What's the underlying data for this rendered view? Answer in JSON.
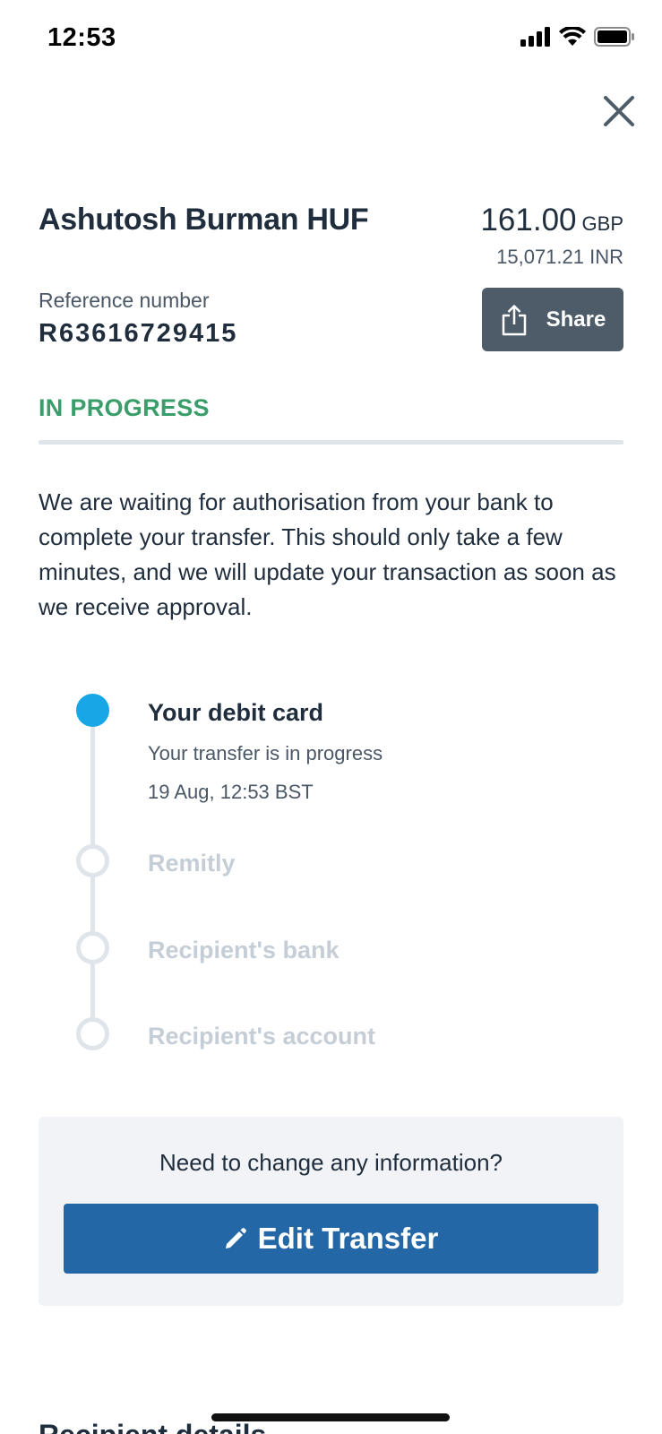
{
  "status_bar": {
    "time": "12:53",
    "icons": [
      "signal-icon",
      "wifi-icon",
      "battery-icon"
    ]
  },
  "transfer": {
    "recipient_name": "Ashutosh Burman HUF",
    "amount": "161.00",
    "currency": "GBP",
    "converted_amount": "15,071.21 INR",
    "reference_label": "Reference number",
    "reference_value": "R63616729415",
    "share_label": "Share",
    "status": "IN PROGRESS",
    "message": "We are waiting for authorisation from your bank to complete your transfer. This should only take a few minutes, and we will update your transaction as soon as we receive approval."
  },
  "timeline": {
    "steps": [
      {
        "title": "Your debit card",
        "subtitle": "Your transfer is in progress",
        "timestamp": "19 Aug, 12:53 BST",
        "active": true
      },
      {
        "title": "Remitly",
        "active": false
      },
      {
        "title": "Recipient's bank",
        "active": false
      },
      {
        "title": "Recipient's account",
        "active": false
      }
    ]
  },
  "change_box": {
    "question": "Need to change any information?",
    "edit_label": "Edit Transfer"
  },
  "next_section": {
    "heading": "Recipient details"
  },
  "colors": {
    "status_green": "#3a9e6a",
    "active_dot": "#17a7e6",
    "edit_button": "#2367a6",
    "share_button": "#4d5c68"
  }
}
